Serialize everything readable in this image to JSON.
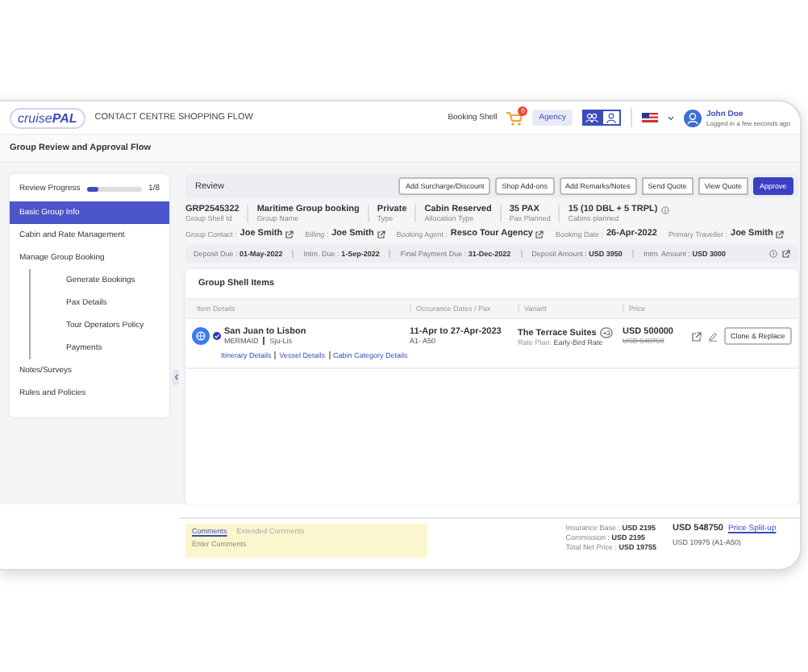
{
  "header": {
    "logo": "cruise**PAL**",
    "app_title": "CONTACT CENTRE SHOPPING FLOW",
    "booking_label": "Booking Shell",
    "cart_count": "0",
    "agency": "Agency",
    "toggles": [
      {
        "kind": "group",
        "selected": true
      },
      {
        "kind": "person",
        "selected": false
      }
    ],
    "user": {
      "name": "John Doe",
      "status": "Logged in a few seconds ago"
    }
  },
  "page_title": "Group Review and Approval Flow",
  "sidebar": {
    "progress": {
      "label": "Review Progress",
      "level": 0.22,
      "reading": "1/8"
    },
    "items": [
      {
        "label": "Basic Group Info",
        "selected": true
      },
      {
        "label": "Cabin and Rate Management",
        "selected": false
      },
      {
        "label": "Manage Group Booking",
        "selected": false,
        "children": [
          {
            "label": "Generate Bookings",
            "selected": false
          },
          {
            "label": "Pax Details",
            "selected": false
          },
          {
            "label": "Tour Operators Policy",
            "selected": false
          },
          {
            "label": "Payments",
            "selected": false
          }
        ]
      },
      {
        "label": "Notes/Surveys",
        "selected": false
      },
      {
        "label": "Rules and Policies",
        "selected": false
      }
    ]
  },
  "review": {
    "title": "Review",
    "actions": [
      {
        "label": "Add Surcharge/Discount",
        "kind": "plain"
      },
      {
        "label": "Shop Add-ons",
        "kind": "plain"
      },
      {
        "label": "Add Remarks/Notes",
        "kind": "plain"
      },
      {
        "label": "Send Quote",
        "kind": "joined"
      },
      {
        "label": "View Quote",
        "kind": "joined"
      },
      {
        "label": "Approve",
        "kind": "primary"
      }
    ],
    "summary": [
      {
        "value": "GRP2545322",
        "label": "Group Shell Id",
        "info": false
      },
      {
        "value": "Maritime Group booking",
        "label": "Group Name",
        "info": false
      },
      {
        "value": "Private",
        "label": "Type",
        "info": false
      },
      {
        "value": "Cabin Reserved",
        "label": "Allocation Type",
        "info": false
      },
      {
        "value": "35 PAX",
        "label": "Pax Planned",
        "info": false
      },
      {
        "value": "15 (10 DBL + 5 TRPL)",
        "label": "Cabins planned",
        "info": true
      }
    ],
    "contacts": [
      {
        "label": "Group Contact :",
        "value": "Joe Smith",
        "link": true
      },
      {
        "label": "Billing :",
        "value": "Joe Smith",
        "link": true
      },
      {
        "label": "Booking Agent :",
        "value": "Resco Tour Agency",
        "link": true
      },
      {
        "label": "Booking Date :",
        "value": "26-Apr-2022",
        "link": false
      },
      {
        "label": "Primary Traveller :",
        "value": "Joe Smith",
        "link": true
      }
    ],
    "dues": [
      {
        "label": "Deposit Due :",
        "value": "01-May-2022"
      },
      {
        "label": "Intm. Due :",
        "value": "1-Sep-2022"
      },
      {
        "label": "Final Payment Due :",
        "value": "31-Dec-2022"
      },
      {
        "label": "Deposit Amount :",
        "value": "USD 3950"
      },
      {
        "label": "Intm. Amount :",
        "value": "USD 3000"
      }
    ]
  },
  "items": {
    "title": "Group Shell Items",
    "columns": [
      "Item Details",
      "Occurance Dates / Pax",
      "Variant",
      "Price"
    ],
    "rows": [
      {
        "route": "San Juan to Lisbon",
        "verified": true,
        "ship": "MERMAID",
        "code": "Sju-Lis",
        "links": [
          "Itinerary Details",
          "Vessel Details",
          "Cabin Category Details"
        ],
        "dates": "11-Apr to 27-Apr-2023",
        "pax": "A1- A50",
        "variant": "The Terrace Suites",
        "more": "+3",
        "rate_label": "Rate Plan:",
        "rate": "Early-Bird Rate",
        "price": "USD 500000",
        "old_price": "USD 548750",
        "button": "Clone & Replace"
      }
    ]
  },
  "footer": {
    "comment_tabs": [
      {
        "label": "Comments",
        "selected": true
      },
      {
        "label": "Extended Comments",
        "selected": false
      }
    ],
    "placeholder": "Enter Comments",
    "breakdown": [
      {
        "label": "Insurance Base :",
        "value": "USD 2195"
      },
      {
        "label": "Commission :",
        "value": "USD 2195"
      },
      {
        "label": "Total Net Price :",
        "value": "USD 19755"
      }
    ],
    "total": "USD 548750",
    "split_link": "Price Split-up",
    "per_pax": "USD 10975",
    "range": "(A1-A50)"
  }
}
